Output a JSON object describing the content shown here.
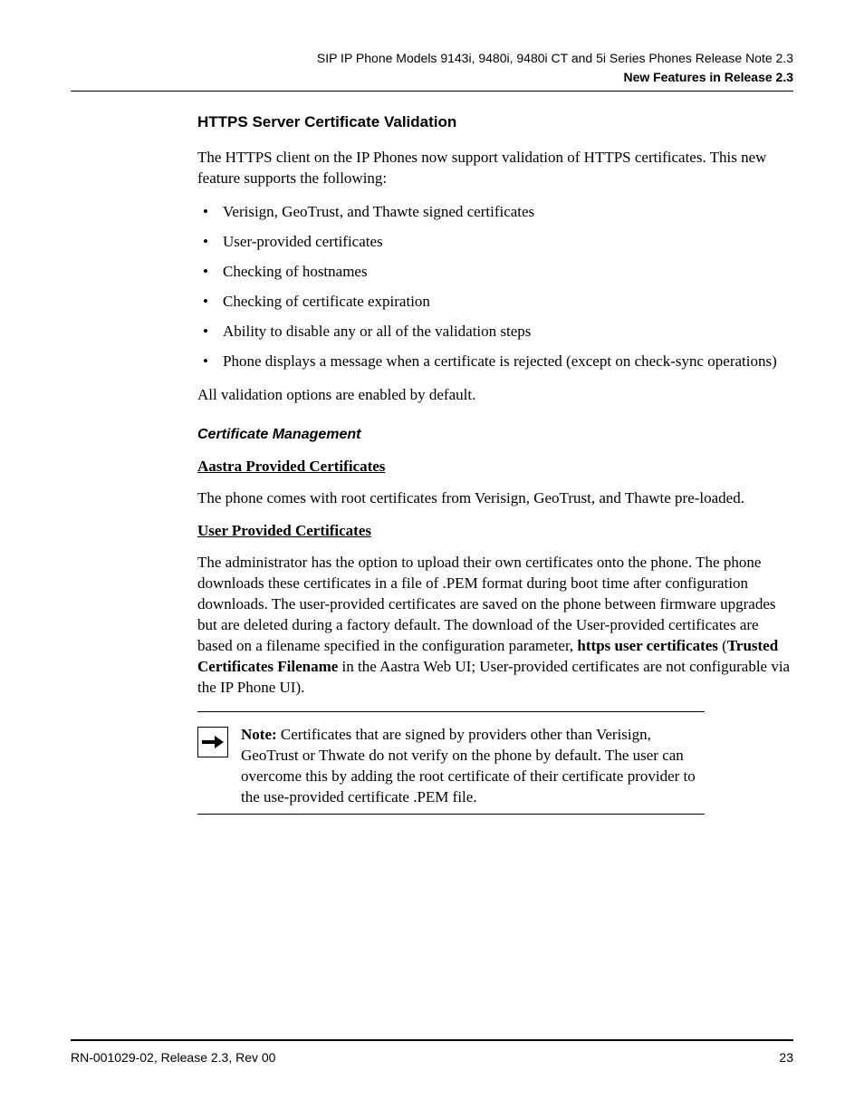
{
  "header": {
    "line1": "SIP IP Phone Models 9143i, 9480i, 9480i CT and 5i Series Phones Release Note 2.3",
    "line2": "New Features in Release 2.3"
  },
  "section": {
    "title": "HTTPS Server Certificate Validation",
    "intro": "The HTTPS client on the IP Phones now support validation of HTTPS certificates. This new feature supports the following:",
    "bullets": [
      "Verisign, GeoTrust, and Thawte signed certificates",
      "User-provided certificates",
      "Checking of hostnames",
      "Checking of certificate expiration",
      "Ability to disable any or all of the validation steps",
      "Phone displays a message when a certificate is rejected (except on check-sync operations)"
    ],
    "closing": "All validation options are enabled by default."
  },
  "subsection": {
    "title": "Certificate Management",
    "aastra": {
      "heading": "Aastra Provided Certificates",
      "text": "The phone comes with root certificates from Verisign, GeoTrust, and Thawte pre-loaded."
    },
    "user": {
      "heading": "User Provided Certificates",
      "text_before": "The administrator has the option to upload their own certificates onto the phone. The phone downloads these certificates in a file of .PEM format during boot time after configuration downloads. The user-provided certificates are saved on the phone between firmware upgrades but are deleted during a factory default. The download of the User-provided certificates are based on a filename specified in the configuration parameter, ",
      "bold1": "https user certificates",
      "mid1": " (",
      "bold2": "Trusted Certificates Filename",
      "text_after": " in the Aastra Web UI; User-provided certificates are not configurable via the IP Phone UI)."
    }
  },
  "note": {
    "label": "Note:",
    "text": " Certificates that are signed by providers other than Verisign, GeoTrust or Thwate do not verify on the phone by default. The user can overcome this by adding the root certificate of their certificate provider to the use-provided certificate .PEM file."
  },
  "footer": {
    "left": "RN-001029-02, Release 2.3, Rev 00",
    "right": "23"
  }
}
